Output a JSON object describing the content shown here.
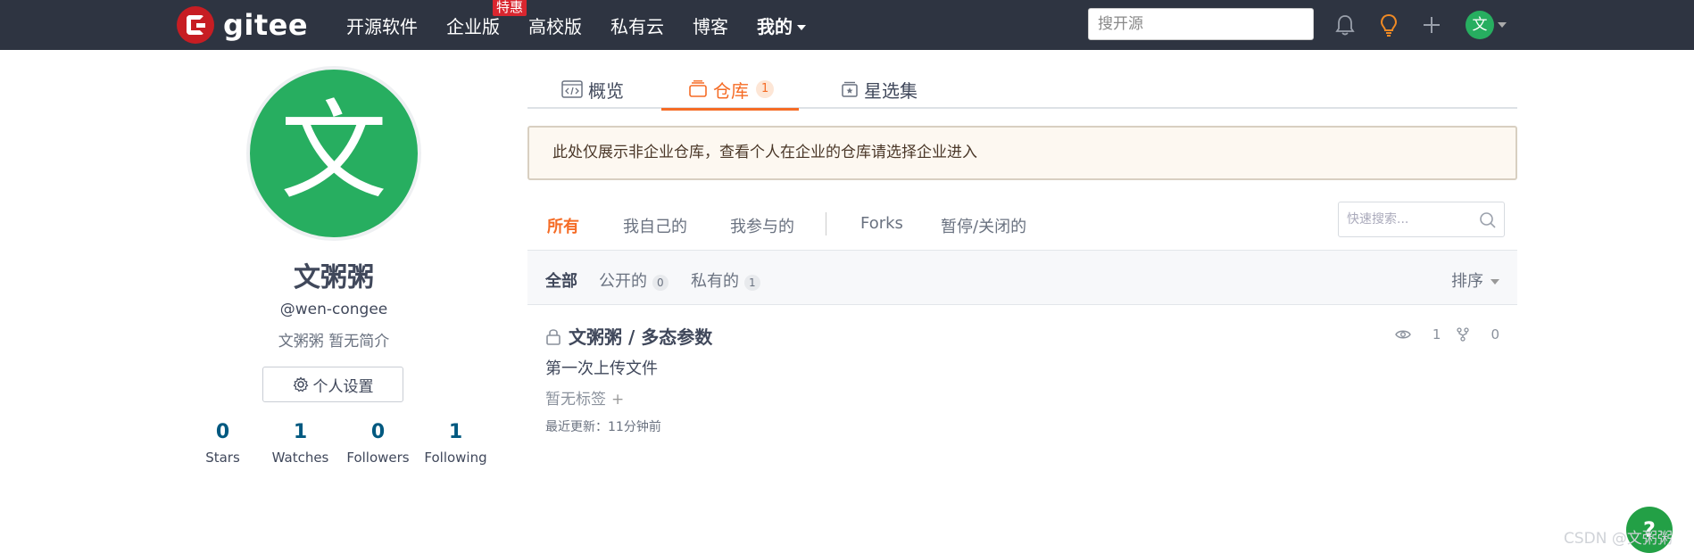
{
  "header": {
    "logo_text": "gitee",
    "nav": [
      {
        "label": "开源软件"
      },
      {
        "label": "企业版",
        "badge": "特惠"
      },
      {
        "label": "高校版"
      },
      {
        "label": "私有云"
      },
      {
        "label": "博客"
      },
      {
        "label": "我的"
      }
    ],
    "search_placeholder": "搜开源",
    "user_avatar_char": "文"
  },
  "profile": {
    "avatar_char": "文",
    "name": "文粥粥",
    "username": "@wen-congee",
    "bio": "文粥粥 暂无简介",
    "settings_label": "个人设置",
    "stats": [
      {
        "value": "0",
        "label": "Stars"
      },
      {
        "value": "1",
        "label": "Watches"
      },
      {
        "value": "0",
        "label": "Followers"
      },
      {
        "value": "1",
        "label": "Following"
      }
    ]
  },
  "tabs": [
    {
      "label": "概览",
      "icon": "overview-icon"
    },
    {
      "label": "仓库",
      "count": "1",
      "icon": "repo-icon",
      "active": true
    },
    {
      "label": "星选集",
      "icon": "collection-icon"
    }
  ],
  "notice": "此处仅展示非企业仓库，查看个人在企业的仓库请选择企业进入",
  "filters": {
    "items": [
      "所有",
      "我自己的",
      "我参与的",
      "Forks",
      "暂停/关闭的"
    ],
    "active": "所有",
    "search_placeholder": "快速搜索..."
  },
  "subfilters": {
    "items": [
      {
        "label": "全部"
      },
      {
        "label": "公开的",
        "count": "0"
      },
      {
        "label": "私有的",
        "count": "1"
      }
    ],
    "sort_label": "排序"
  },
  "repo": {
    "title": "文粥粥 / 多态参数",
    "description": "第一次上传文件",
    "tags": "暂无标签",
    "tags_add": "+",
    "updated": "最近更新：11分钟前",
    "watch_count": "1",
    "fork_count": "0"
  },
  "help_label": "?",
  "watermark": "CSDN @文粥粥",
  "colors": {
    "nav_bg": "#2e3441",
    "accent": "#f56c26",
    "avatar_green": "#27ae60",
    "brand_red": "#c71d23"
  }
}
